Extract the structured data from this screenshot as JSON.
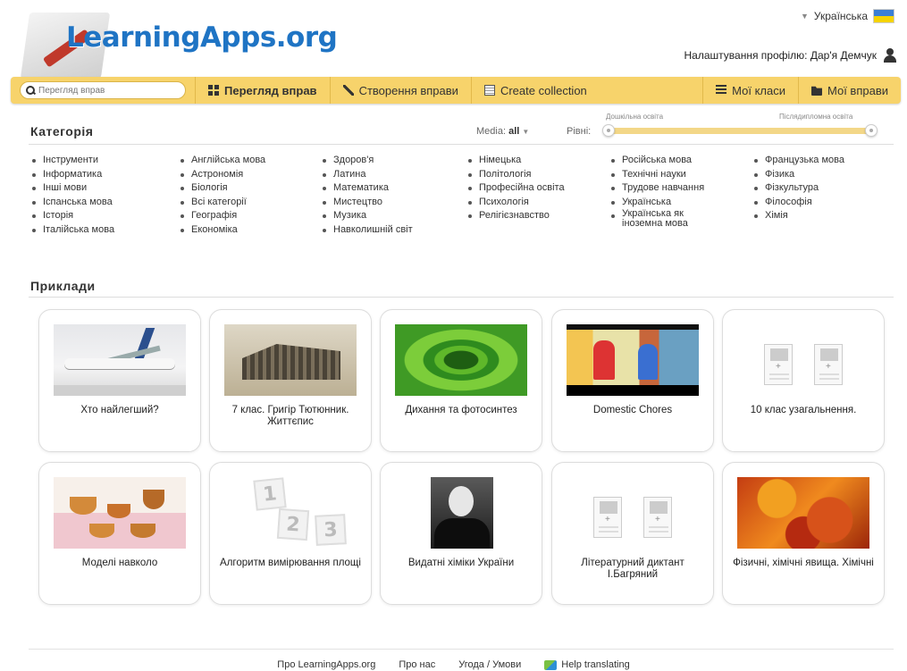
{
  "header": {
    "logo_text": "LearningApps.org",
    "language": "Українська",
    "profile_text": "Налаштування профілю: Дар'я Демчук"
  },
  "nav": {
    "search_placeholder": "Перегляд вправ",
    "browse": "Перегляд вправ",
    "create": "Створення вправи",
    "collection": "Create collection",
    "classes": "Мої класи",
    "my_apps": "Мої вправи"
  },
  "filters": {
    "category_title": "Категорія",
    "media_label": "Media:",
    "media_value": "all",
    "levels_label": "Рівні:",
    "level_min": "Дошкільна освіта",
    "level_max": "Післядипломна освіта"
  },
  "categories": {
    "col1": [
      "Інструменти",
      "Інформатика",
      "Інші мови",
      "Іспанська мова",
      "Історія",
      "Італійська мова"
    ],
    "col2": [
      "Англійська мова",
      "Астрономія",
      "Біологія",
      "Всі категорії",
      "Географія",
      "Економіка"
    ],
    "col3": [
      "Здоров'я",
      "Латина",
      "Математика",
      "Мистецтво",
      "Музика",
      "Навколишній світ"
    ],
    "col4": [
      "Німецька",
      "Політологія",
      "Професійна освіта",
      "Психологія",
      "Релігієзнавство"
    ],
    "col5": [
      "Російська мова",
      "Технічні науки",
      "Трудове навчання",
      "Українська",
      "Українська як іноземна мова"
    ],
    "col6": [
      "Французька мова",
      "Фізика",
      "Фізкультура",
      "Філософія",
      "Хімія"
    ]
  },
  "examples": {
    "title": "Приклади",
    "cards": [
      {
        "label": "Хто найлегший?",
        "thumb": "airplane-photo"
      },
      {
        "label": "7 клас. Григір Тютюнник. Життєпис",
        "thumb": "old-building-photo"
      },
      {
        "label": "Дихання та фотосинтез",
        "thumb": "stoma-microscope-photo"
      },
      {
        "label": "Domestic Chores",
        "thumb": "cartoon-video"
      },
      {
        "label": "10 клас узагальнення.",
        "thumb": "blank-template-icon"
      },
      {
        "label": "Моделі навколо",
        "thumb": "tea-set-photo"
      },
      {
        "label": "Алгоритм вимірювання площі",
        "thumb": "numbers-123-icon"
      },
      {
        "label": "Видатні хіміки України",
        "thumb": "portrait-photo"
      },
      {
        "label": "Літературний диктант І.Багряний",
        "thumb": "blank-template-icon"
      },
      {
        "label": "Фізичні, хімічні явища. Хімічні",
        "thumb": "autumn-leaves-photo"
      }
    ]
  },
  "footer": {
    "about": "Про LearningApps.org",
    "about_us": "Про нас",
    "terms": "Угода / Умови",
    "help_translate": "Help translating"
  },
  "colors": {
    "navbar": "#f7d36b",
    "logo": "#1f74c4",
    "level_track": "#f3d788"
  }
}
